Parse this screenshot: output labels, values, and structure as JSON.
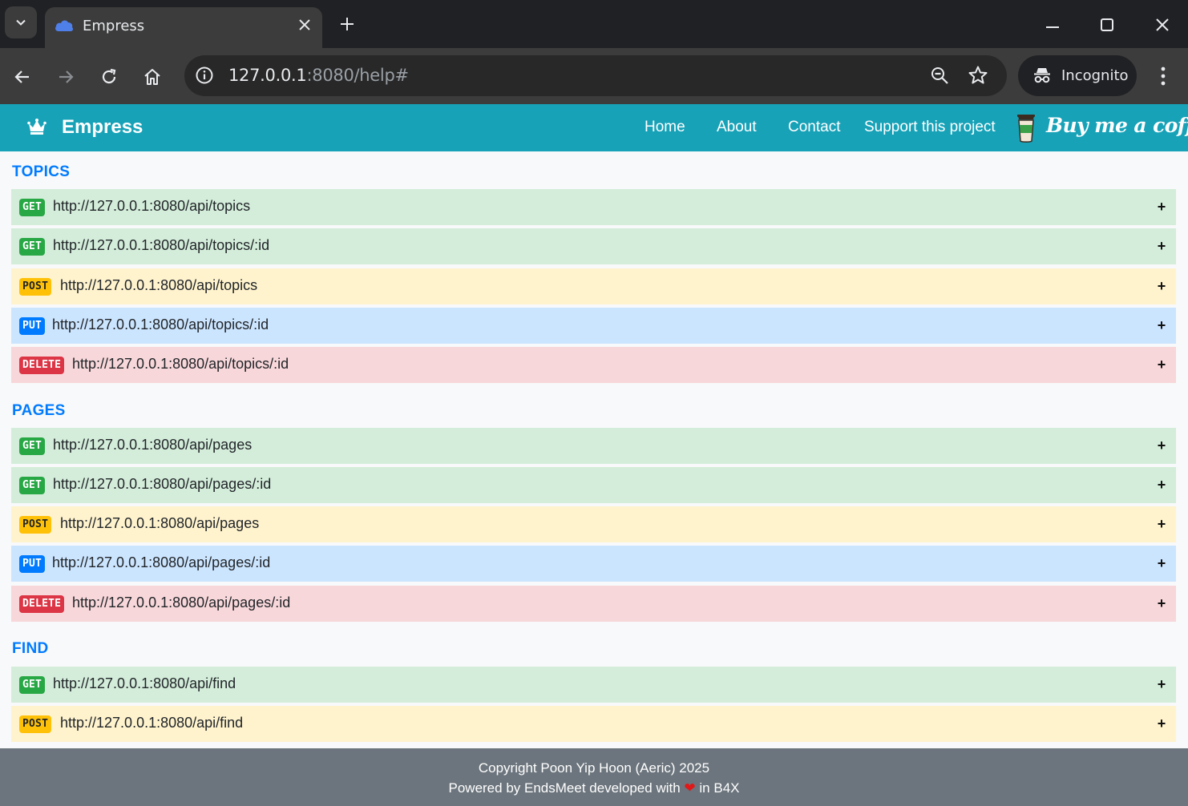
{
  "browser": {
    "tab_title": "Empress",
    "url_host": "127.0.0.1",
    "url_rest": ":8080/help#",
    "incognito_label": "Incognito"
  },
  "navbar": {
    "brand": "Empress",
    "links": [
      "Home",
      "About",
      "Contact",
      "Support this project"
    ],
    "coffee_text": "Buy me a coffee",
    "color": "#17a2b8"
  },
  "sections": [
    {
      "title": "TOPICS",
      "endpoints": [
        {
          "method": "GET",
          "url": "http://127.0.0.1:8080/api/topics",
          "toggle": "+"
        },
        {
          "method": "GET",
          "url": "http://127.0.0.1:8080/api/topics/:id",
          "toggle": "+"
        },
        {
          "method": "POST",
          "url": "http://127.0.0.1:8080/api/topics",
          "toggle": "+"
        },
        {
          "method": "PUT",
          "url": "http://127.0.0.1:8080/api/topics/:id",
          "toggle": "+"
        },
        {
          "method": "DELETE",
          "url": "http://127.0.0.1:8080/api/topics/:id",
          "toggle": "+"
        }
      ]
    },
    {
      "title": "PAGES",
      "endpoints": [
        {
          "method": "GET",
          "url": "http://127.0.0.1:8080/api/pages",
          "toggle": "+"
        },
        {
          "method": "GET",
          "url": "http://127.0.0.1:8080/api/pages/:id",
          "toggle": "+"
        },
        {
          "method": "POST",
          "url": "http://127.0.0.1:8080/api/pages",
          "toggle": "+"
        },
        {
          "method": "PUT",
          "url": "http://127.0.0.1:8080/api/pages/:id",
          "toggle": "+"
        },
        {
          "method": "DELETE",
          "url": "http://127.0.0.1:8080/api/pages/:id",
          "toggle": "+"
        }
      ]
    },
    {
      "title": "FIND",
      "endpoints": [
        {
          "method": "GET",
          "url": "http://127.0.0.1:8080/api/find",
          "toggle": "+"
        },
        {
          "method": "POST",
          "url": "http://127.0.0.1:8080/api/find",
          "toggle": "+"
        }
      ]
    }
  ],
  "footer": {
    "copyright": "Copyright Poon Yip Hoon (Aeric) 2025",
    "powered_prefix": "Powered by EndsMeet developed with",
    "powered_suffix": "in B4X"
  },
  "method_colors": {
    "GET": "#28a745",
    "POST": "#ffc107",
    "PUT": "#007bff",
    "DELETE": "#dc3545"
  }
}
